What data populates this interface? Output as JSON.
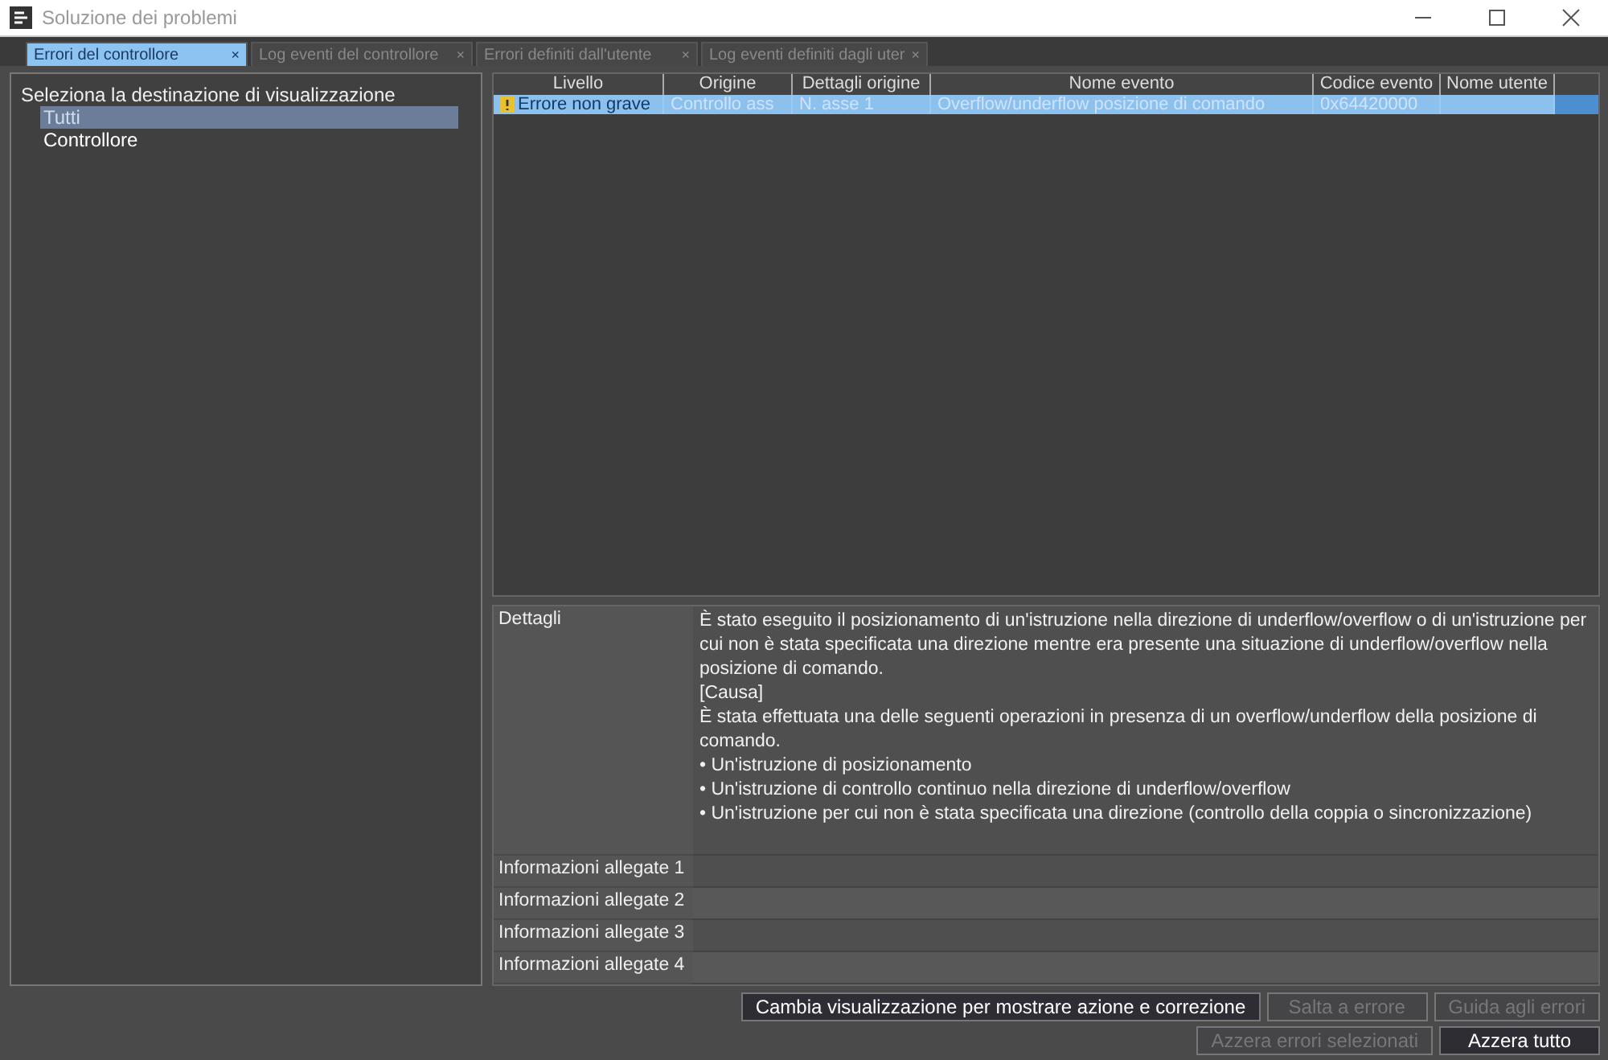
{
  "window": {
    "title": "Soluzione dei problemi"
  },
  "tabs": [
    {
      "label": "Errori del controllore",
      "close": "×",
      "selected": true
    },
    {
      "label": "Log eventi del controllore",
      "close": "×",
      "selected": false
    },
    {
      "label": "Errori definiti dall'utente",
      "close": "×",
      "selected": false
    },
    {
      "label": "Log eventi definiti dagli uter",
      "close": "×",
      "selected": false
    }
  ],
  "sidebar": {
    "title": "Seleziona la destinazione di visualizzazione",
    "items": [
      {
        "label": "Tutti",
        "selected": true
      },
      {
        "label": "Controllore",
        "selected": false
      }
    ]
  },
  "table": {
    "columns": [
      "Livello",
      "Origine",
      "Dettagli origine",
      "Nome evento",
      "Codice evento",
      "Nome utente"
    ],
    "rows": [
      {
        "selected": true,
        "cells": [
          "Errore non grave",
          "Controllo ass",
          "N. asse 1",
          "Overflow/underflow posizione di comando",
          "0x64420000",
          ""
        ]
      }
    ]
  },
  "details": [
    {
      "label": "Dettagli",
      "lines": [
        "È stato eseguito il posizionamento di un'istruzione nella direzione di underflow/overflow o di un'istruzione per cui non è stata specificata una direzione mentre era presente una situazione di underflow/overflow nella posizione di comando.",
        "[Causa]",
        "È stata effettuata una delle seguenti operazioni in presenza di un overflow/underflow della posizione di comando.",
        "• Un'istruzione di posizionamento",
        "• Un'istruzione di controllo continuo nella direzione di underflow/overflow",
        "• Un'istruzione per cui non è stata specificata una direzione (controllo della coppia o sincronizzazione)"
      ]
    },
    {
      "label": "Informazioni allegate 1"
    },
    {
      "label": "Informazioni allegate 2"
    },
    {
      "label": "Informazioni allegate 3"
    },
    {
      "label": "Informazioni allegate 4"
    }
  ],
  "buttons": [
    [
      {
        "label": "Cambia visualizzazione per mostrare azione e correzione",
        "disabled": false
      },
      {
        "label": "Salta a errore",
        "disabled": true
      },
      {
        "label": "Guida agli errori",
        "disabled": true
      }
    ],
    [
      {
        "label": "Azzera errori selezionati",
        "disabled": true
      },
      {
        "label": "Azzera tutto",
        "disabled": false
      }
    ]
  ]
}
